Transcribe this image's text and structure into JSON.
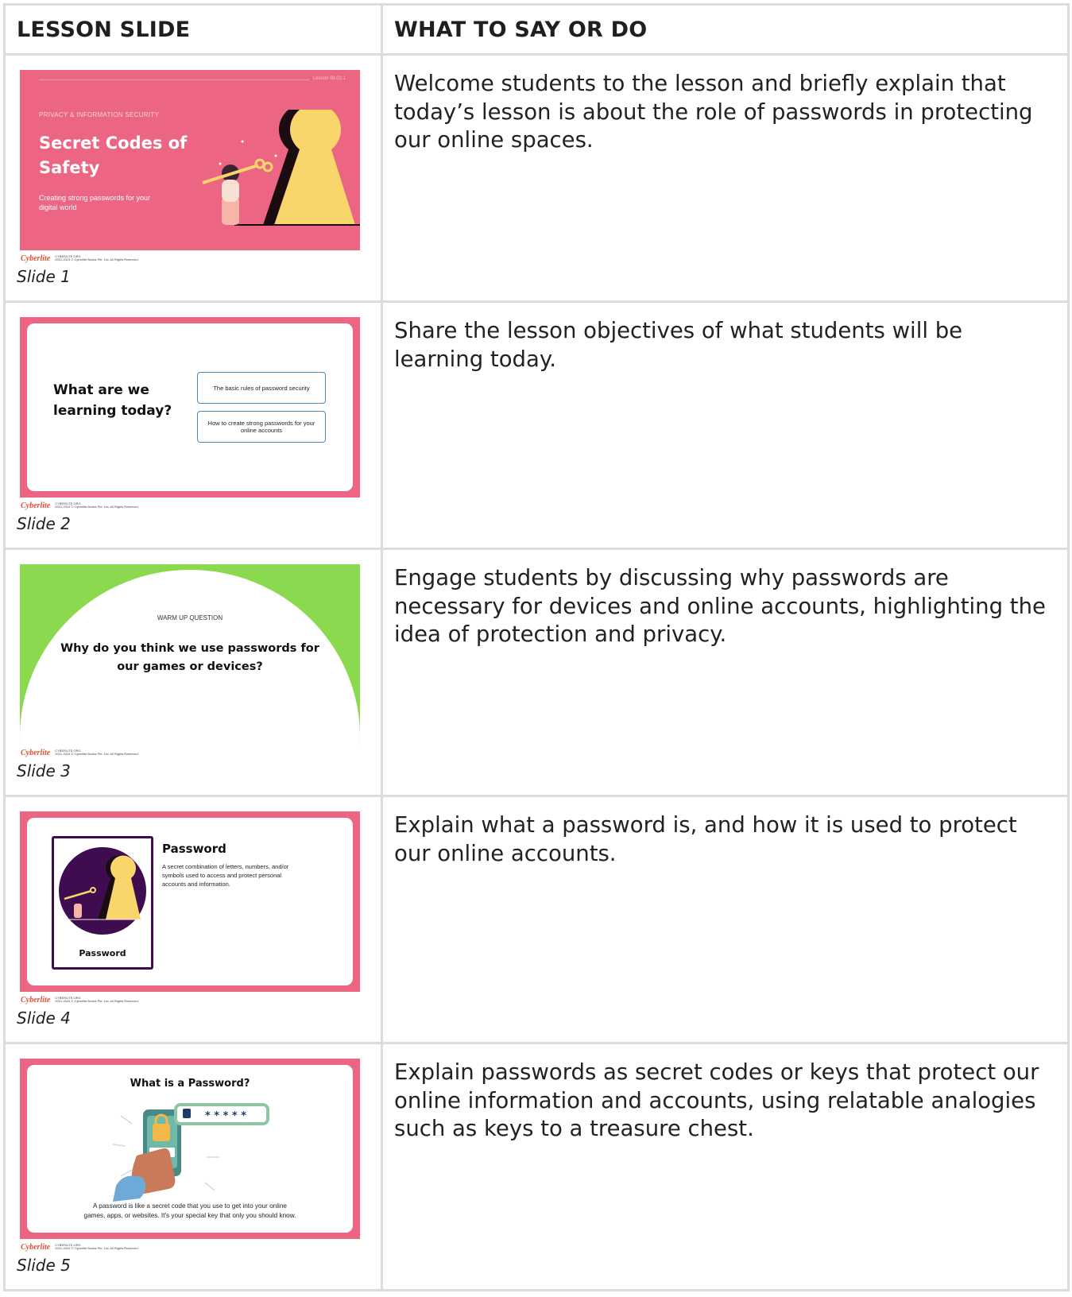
{
  "table": {
    "headers": [
      "LESSON SLIDE",
      "WHAT TO SAY OR DO"
    ]
  },
  "rows": [
    {
      "caption": "Slide 1",
      "say": "Welcome students to the lesson and briefly explain that today’s lesson is about the role of passwords in protecting our online spaces.",
      "slide": {
        "lesson_code": "Lesson 08.02.1",
        "category": "PRIVACY & INFORMATION SECURITY",
        "title_line1": "Secret Codes of",
        "title_line2": "Safety",
        "subtitle_line1": "Creating strong passwords for your",
        "subtitle_line2": "digital world"
      }
    },
    {
      "caption": "Slide 2",
      "say": "Share the lesson objectives of what students will be learning today.",
      "slide": {
        "heading_line1": "What are we",
        "heading_line2": "learning today?",
        "objective1": "The basic rules of password security",
        "objective2_line1": "How to create strong passwords for your",
        "objective2_line2": "online accounts"
      }
    },
    {
      "caption": "Slide 3",
      "say": "Engage students by discussing why passwords are necessary for devices and online accounts, highlighting the idea of protection and privacy.",
      "slide": {
        "kicker": "WARM UP QUESTION",
        "question_line1": "Why do you think we use passwords for",
        "question_line2": "our games or devices?"
      }
    },
    {
      "caption": "Slide 4",
      "say": "Explain what a password is, and how it is used to protect our online accounts.",
      "slide": {
        "term": "Password",
        "definition_line1": "A secret combination of letters, numbers, and/or",
        "definition_line2": "symbols used to access and protect personal",
        "definition_line3": "accounts and information.",
        "card_label": "Password"
      }
    },
    {
      "caption": "Slide 5",
      "say": "Explain passwords as secret codes or keys that protect our online information and accounts, using relatable analogies such as keys to a treasure chest.",
      "slide": {
        "title": "What is a Password?",
        "stars": "* * * * *",
        "screen_code": "****",
        "body_line1": "A password is like a secret code that you use to get into your online",
        "body_line2": "games, apps, or websites. It's your special key that only you should know."
      }
    }
  ],
  "footer": {
    "brand": "Cyberlite",
    "line1": "CYBERLITE.ORG",
    "line2": "2021-2024 © Cyberlite Books Pte. Ltd. All Rights Reserved."
  },
  "colors": {
    "pink": "#ec6583",
    "green": "#8bd94e",
    "yellow": "#f9d66b",
    "purple": "#3f0d4f",
    "blue_outline": "#4b86c5"
  }
}
